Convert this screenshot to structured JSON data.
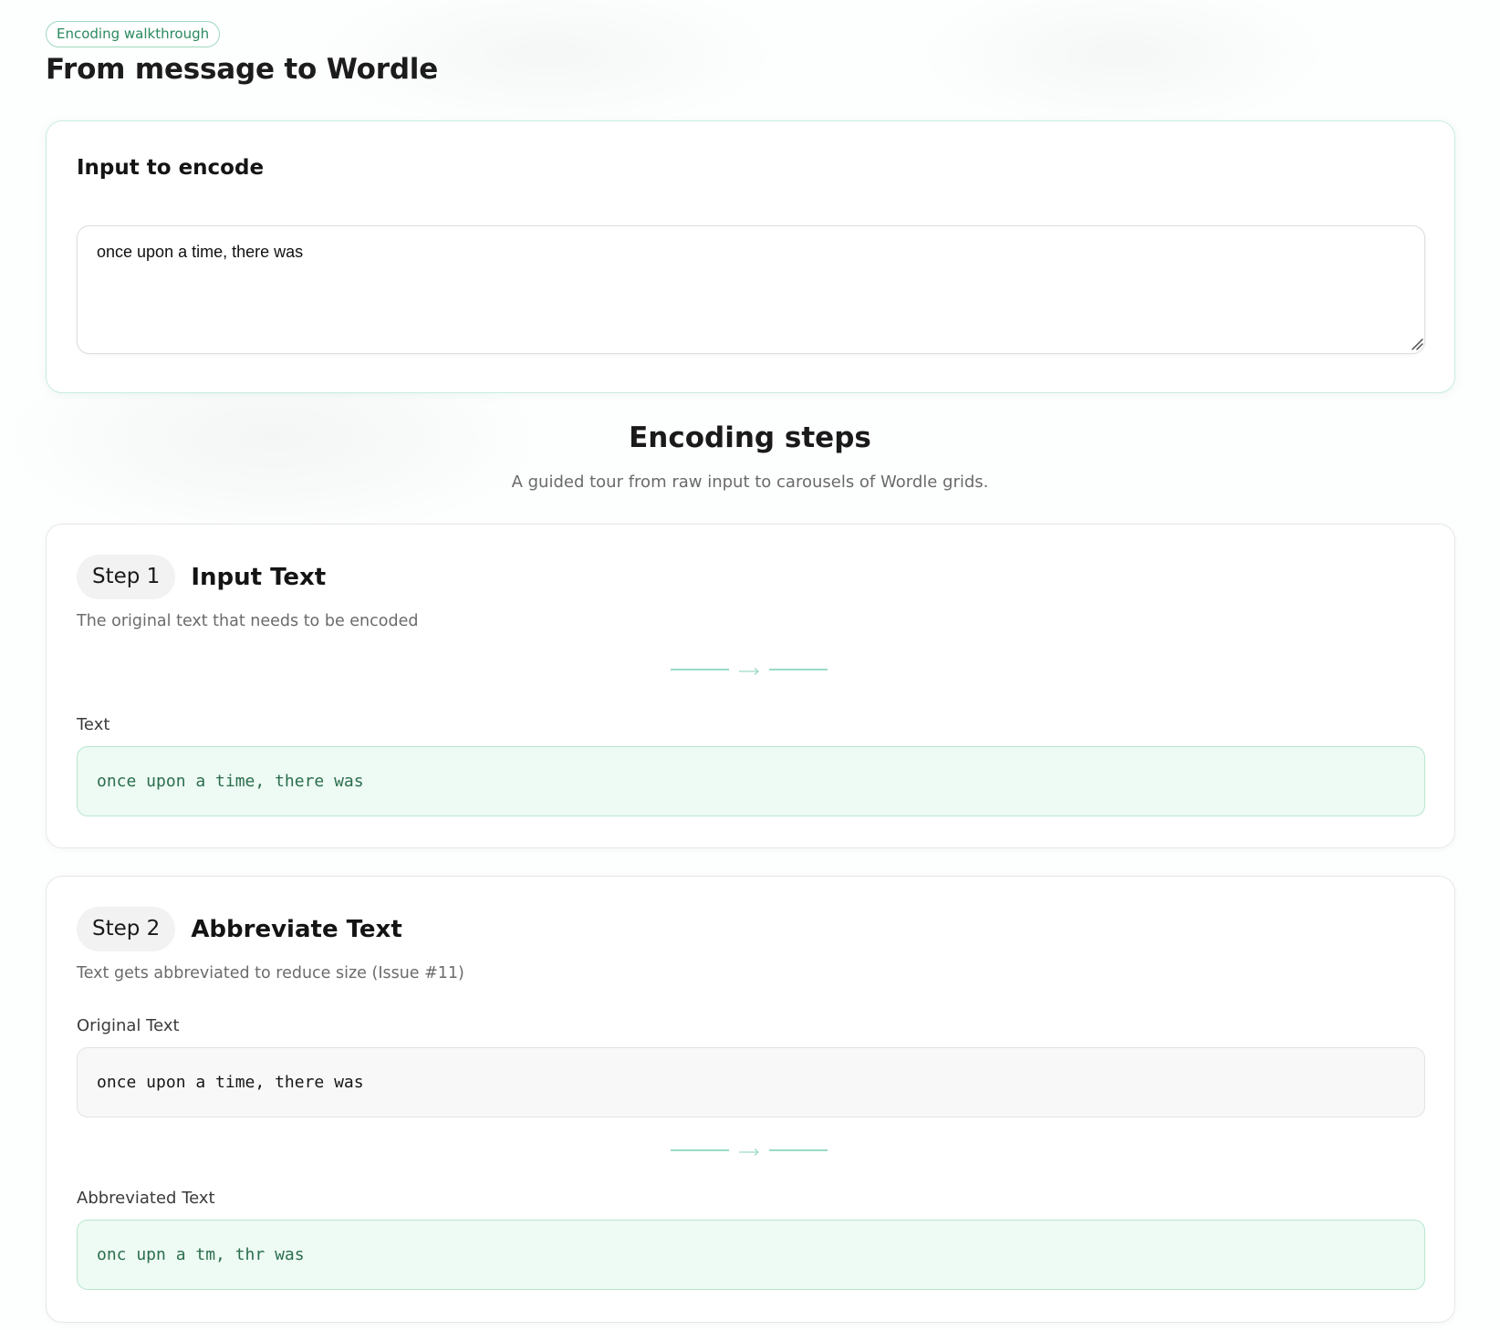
{
  "header": {
    "badge": "Encoding walkthrough",
    "title": "From message to Wordle"
  },
  "input_card": {
    "title": "Input to encode",
    "textarea_value": "once upon a time, there was"
  },
  "steps_section": {
    "heading": "Encoding steps",
    "subheading": "A guided tour from raw input to carousels of Wordle grids."
  },
  "steps": [
    {
      "pill": "Step 1",
      "title": "Input Text",
      "description": "The original text that needs to be encoded",
      "output_label": "Text",
      "output_value": "once upon a time, there was"
    },
    {
      "pill": "Step 2",
      "title": "Abbreviate Text",
      "description": "Text gets abbreviated to reduce size (Issue #11)",
      "input_label": "Original Text",
      "input_value": "once upon a time, there was",
      "output_label": "Abbreviated Text",
      "output_value": "onc upn a tm, thr was"
    }
  ],
  "icons": {
    "arrow": "arrow-right-icon",
    "grip": "resize-grip-icon"
  },
  "colors": {
    "accent": "#2a8a5f",
    "accent_border": "#9fd9bf",
    "output_bg": "#eefaf4",
    "output_text": "#2b6e4d",
    "divider": "#5cc4a6"
  }
}
